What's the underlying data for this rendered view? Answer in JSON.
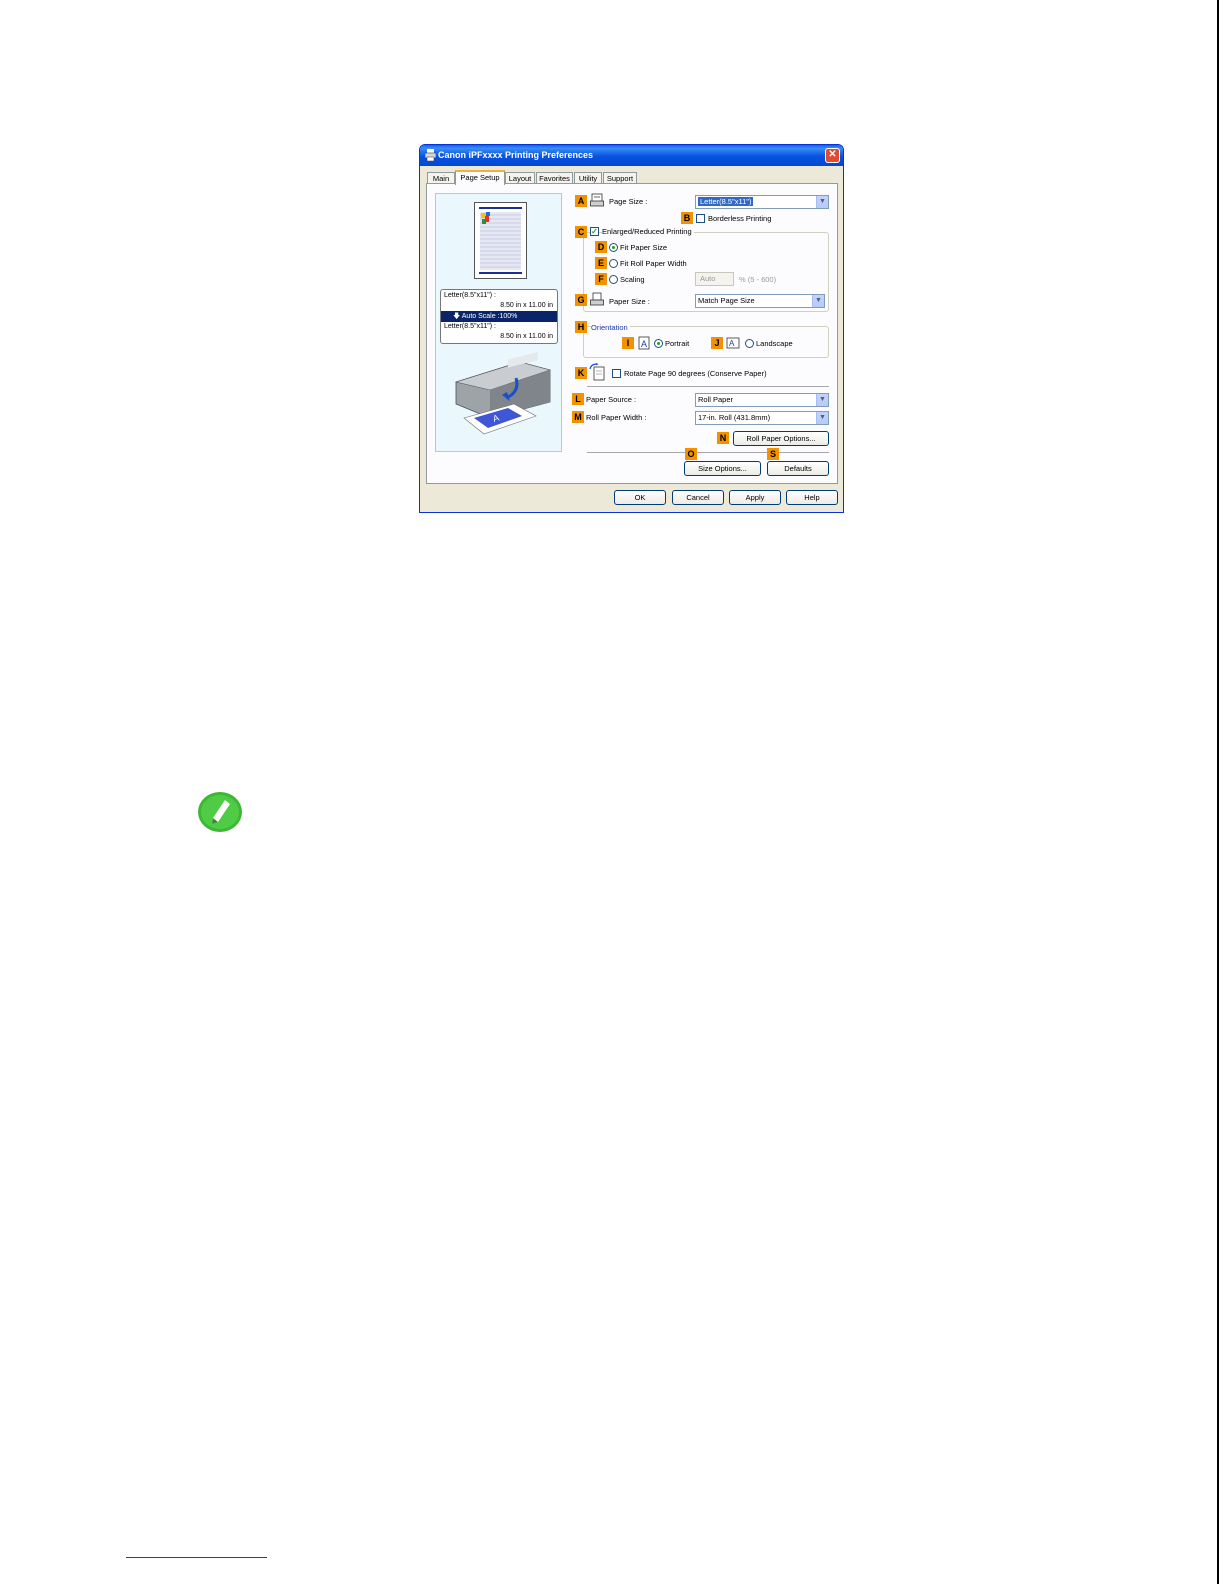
{
  "dialog": {
    "title": "Canon iPFxxxx Printing Preferences",
    "close_label": "✕",
    "tabs": [
      "Main",
      "Page Setup",
      "Layout",
      "Favorites",
      "Utility",
      "Support"
    ],
    "active_tab": "Page Setup"
  },
  "preview": {
    "info_line1": "Letter(8.5\"x11\") :",
    "info_line2": "8.50 in x 11.00 in",
    "info_highlight": "🡇  Auto Scale :100%",
    "info_line3": "Letter(8.5\"x11\") :",
    "info_line4": "8.50 in x 11.00 in"
  },
  "badges": {
    "a": "A",
    "b": "B",
    "c": "C",
    "d": "D",
    "e": "E",
    "f": "F",
    "g": "G",
    "h": "H",
    "i": "I",
    "j": "J",
    "k": "K",
    "l": "L",
    "m": "M",
    "n": "N",
    "o": "O",
    "s": "S"
  },
  "page_setup": {
    "page_size_label": "Page Size :",
    "page_size_value": "Letter(8.5\"x11\")",
    "borderless_label": "Borderless Printing",
    "enlarged_label": "Enlarged/Reduced Printing",
    "enlarged_checked": true,
    "fit_paper_size_label": "Fit Paper Size",
    "fit_roll_width_label": "Fit Roll Paper Width",
    "scaling_label": "Scaling",
    "scaling_value": "Auto",
    "scaling_range": "% (5 - 600)",
    "paper_size_label": "Paper Size :",
    "paper_size_value": "Match Page Size",
    "orientation_label": "Orientation",
    "portrait_label": "Portrait",
    "landscape_label": "Landscape",
    "rotate_label": "Rotate Page 90 degrees (Conserve Paper)",
    "paper_source_label": "Paper Source :",
    "paper_source_value": "Roll Paper",
    "roll_width_label": "Roll Paper Width :",
    "roll_width_value": "17-in. Roll (431.8mm)",
    "roll_options_button": "Roll Paper Options...",
    "size_options_button": "Size Options...",
    "defaults_button": "Defaults"
  },
  "footer_buttons": {
    "ok": "OK",
    "cancel": "Cancel",
    "apply": "Apply",
    "help": "Help"
  },
  "colors": {
    "badge": "#f39200",
    "titlebar": "#0553e1",
    "note_icon": "#3cb834"
  },
  "icons": [
    "printer-icon",
    "page-size-icon",
    "paper-size-icon",
    "portrait-icon",
    "landscape-icon",
    "rotate-icon",
    "note-pencil-icon"
  ]
}
